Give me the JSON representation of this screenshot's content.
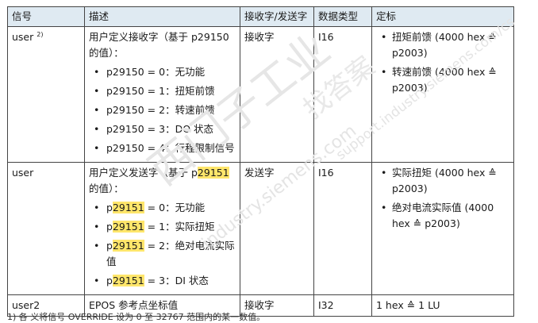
{
  "headers": {
    "signal": "信号",
    "desc": "描述",
    "rxtx": "接收字/发送字",
    "dtype": "数据类型",
    "scale": "定标"
  },
  "rows": [
    {
      "signal": "user",
      "sup": "2)",
      "desc_intro": "用户定义接收字（基于 p29150 的值）：",
      "desc_items": [
        "p29150 = 0：无功能",
        "p29150 = 1：扭矩前馈",
        "p29150 = 2：转速前馈",
        "p29150 = 3：DO 状态",
        "p29150 = 4：行程限制信号"
      ],
      "rxtx": "接收字",
      "dtype": "I16",
      "scale_items": [
        "扭矩前馈 (4000 hex ≙ p2003)",
        "转速前馈 (4000 hex ≙ p2003)"
      ]
    },
    {
      "signal": "user",
      "desc_intro_a": "用户定义发送字（基于 p",
      "desc_intro_hl": "29151",
      "desc_intro_b": " 的值）：",
      "desc_items": [
        {
          "a": "p",
          "hl": "29151",
          "b": " = 0：无功能"
        },
        {
          "a": "p",
          "hl": "29151",
          "b": " = 1：实际扭矩"
        },
        {
          "a": "p",
          "hl": "29151",
          "b": " = 2：绝对电流实际值"
        },
        {
          "a": "p",
          "hl": "29151",
          "b": " = 3：DI 状态"
        }
      ],
      "rxtx": "发送字",
      "dtype": "I16",
      "scale_items": [
        "实际扭矩 (4000 hex ≙ p2003)",
        "绝对电流实际值 (4000 hex ≙ p2003)"
      ]
    },
    {
      "signal": "user2",
      "desc": "EPOS 参考点坐标值",
      "rxtx": "接收字",
      "dtype": "I32",
      "scale": "1 hex ≙ 1 LU"
    }
  ],
  "footnote": "1)  各 义将信号 OVERRIDE 设为 0 至 32767 范围内的某一数值。",
  "watermarks": [
    "西门子工业",
    "找答案",
    "industry.siemens.com",
    "support.industry.siemens.com/cs"
  ]
}
